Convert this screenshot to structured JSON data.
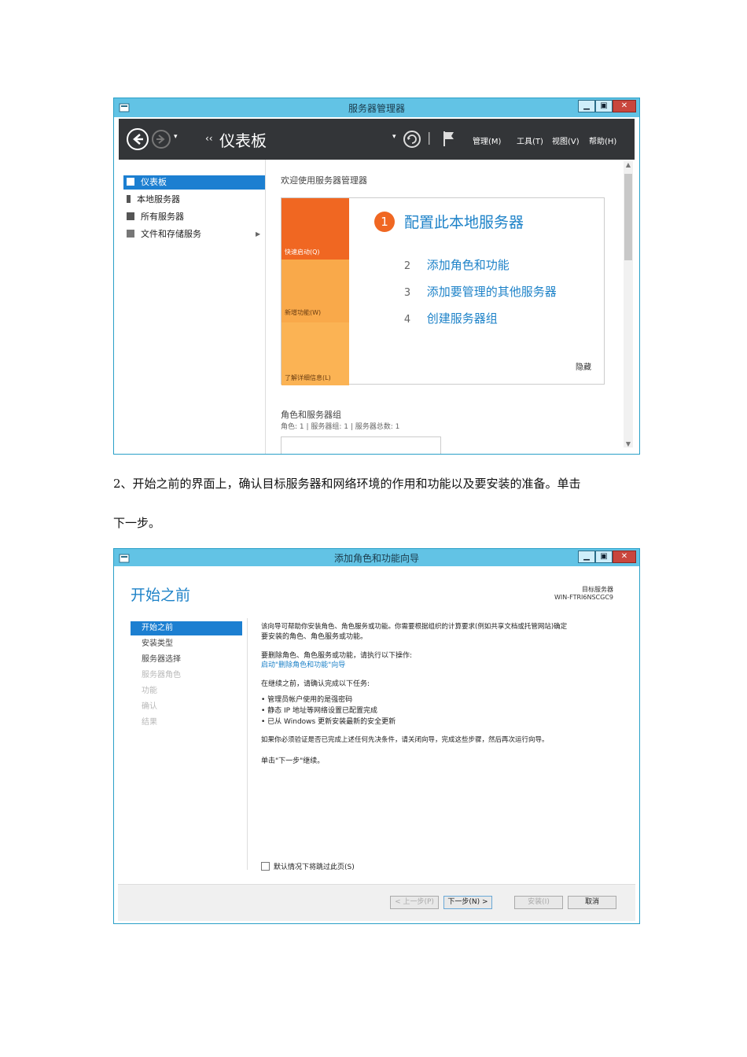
{
  "window1": {
    "title": "服务器管理器",
    "toolbar": {
      "breadcrumb_arrows": "‹‹",
      "title": "仪表板",
      "menus": [
        "管理(M)",
        "工具(T)",
        "视图(V)",
        "帮助(H)"
      ]
    },
    "sidebar": [
      {
        "label": "仪表板",
        "selected": true
      },
      {
        "label": "本地服务器",
        "selected": false
      },
      {
        "label": "所有服务器",
        "selected": false
      },
      {
        "label": "文件和存储服务",
        "selected": false
      }
    ],
    "welcome": "欢迎使用服务器管理器",
    "tiles": [
      "快速启动(Q)",
      "新增功能(W)",
      "了解详细信息(L)"
    ],
    "tasks": [
      {
        "num": "1",
        "label": "配置此本地服务器"
      },
      {
        "num": "2",
        "label": "添加角色和功能"
      },
      {
        "num": "3",
        "label": "添加要管理的其他服务器"
      },
      {
        "num": "4",
        "label": "创建服务器组"
      }
    ],
    "hide_link": "隐藏",
    "roles_title": "角色和服务器组",
    "roles_stats": "角色: 1 | 服务器组: 1 | 服务器总数: 1",
    "colors": {
      "accent_orange": "#f06722",
      "tile_orange": "#f9a94a",
      "selection": "#1c7fd1"
    }
  },
  "paragraph": {
    "line1": "2、开始之前的界面上，确认目标服务器和网络环境的作用和功能以及要安装的准备。单击",
    "line2": "下一步。"
  },
  "window2": {
    "title": "添加角色和功能向导",
    "heading": "开始之前",
    "target_label": "目标服务器",
    "target_value": "WIN-FTRI6NSCGC9",
    "nav": [
      {
        "label": "开始之前",
        "state": "selected"
      },
      {
        "label": "安装类型",
        "state": "normal"
      },
      {
        "label": "服务器选择",
        "state": "normal"
      },
      {
        "label": "服务器角色",
        "state": "disabled"
      },
      {
        "label": "功能",
        "state": "disabled"
      },
      {
        "label": "确认",
        "state": "disabled"
      },
      {
        "label": "结果",
        "state": "disabled"
      }
    ],
    "content": {
      "intro1": "该向导可帮助你安装角色、角色服务或功能。你需要根据组织的计算要求(例如共享文档或托管网站)确定",
      "intro2": "要安装的角色、角色服务或功能。",
      "remove_text": "要删除角色、角色服务或功能，请执行以下操作:",
      "remove_link": "启动\"删除角色和功能\"向导",
      "before_text": "在继续之前，请确认完成以下任务:",
      "bullets": [
        "管理员帐户使用的是强密码",
        "静态 IP 地址等网络设置已配置完成",
        "已从 Windows 更新安装最新的安全更新"
      ],
      "verify_text": "如果你必须验证是否已完成上述任何先决条件，请关闭向导，完成这些步骤，然后再次运行向导。",
      "next_text": "单击\"下一步\"继续。"
    },
    "skip_checkbox": "默认情况下将跳过此页(S)",
    "buttons": {
      "prev": "< 上一步(P)",
      "next": "下一步(N) >",
      "install": "安装(I)",
      "cancel": "取消"
    }
  }
}
